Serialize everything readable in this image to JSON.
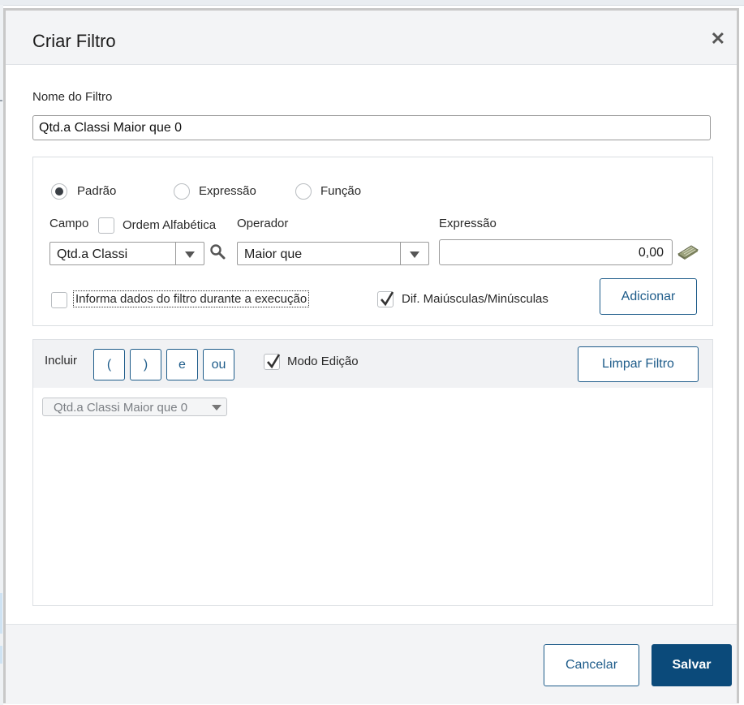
{
  "dialog": {
    "title": "Criar Filtro",
    "close_icon": "close-icon"
  },
  "name_field": {
    "label": "Nome do Filtro",
    "value": "Qtd.a Classi Maior que 0"
  },
  "mode": {
    "options": [
      {
        "label": "Padrão",
        "selected": true
      },
      {
        "label": "Expressão",
        "selected": false
      },
      {
        "label": "Função",
        "selected": false
      }
    ]
  },
  "campo": {
    "label": "Campo",
    "alpha_label": "Ordem Alfabética",
    "alpha_checked": false,
    "value": "Qtd.a Classi",
    "search_icon": "search-icon"
  },
  "operador": {
    "label": "Operador",
    "value": "Maior que"
  },
  "expressao": {
    "label": "Expressão",
    "value": "0,00",
    "calc_icon": "calculator-icon"
  },
  "options": {
    "informa_label": "Informa dados do filtro durante a execução",
    "informa_checked": false,
    "case_label": "Dif. Maiúsculas/Minúsculas",
    "case_checked": true
  },
  "buttons": {
    "adicionar": "Adicionar",
    "limpar": "Limpar Filtro",
    "cancelar": "Cancelar",
    "salvar": "Salvar"
  },
  "toolbar": {
    "incluir_label": "Incluir",
    "tokens": [
      "(",
      ")",
      "e",
      "ou"
    ],
    "modo_edicao_label": "Modo Edição",
    "modo_edicao_checked": true
  },
  "filter_items": [
    {
      "label": "Qtd.a Classi Maior que 0"
    }
  ],
  "colors": {
    "accent": "#0b4a7a",
    "border_accent": "#1e5c8a"
  }
}
